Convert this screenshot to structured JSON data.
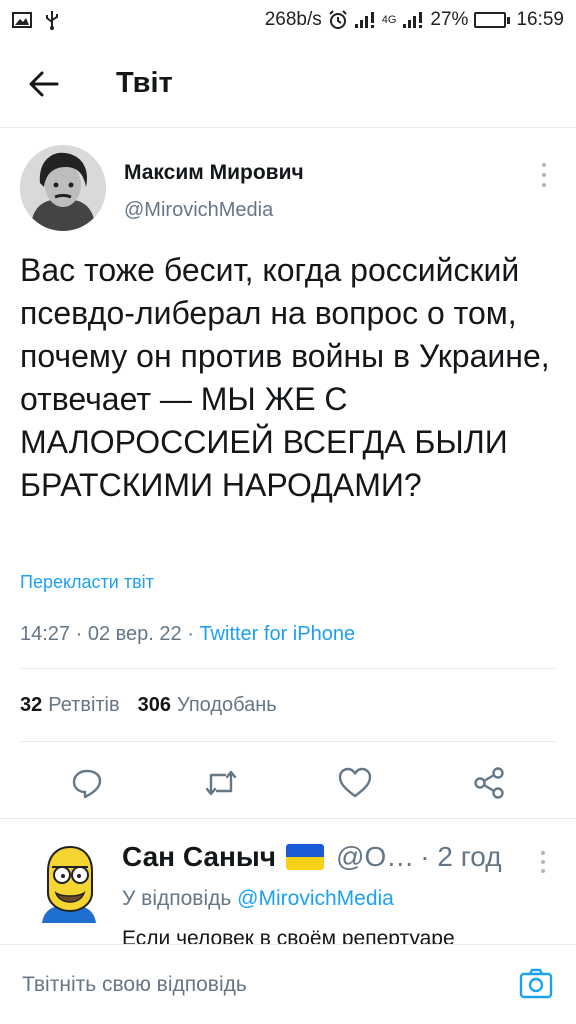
{
  "status_bar": {
    "speed": "268b/s",
    "network": "4G",
    "battery_percent": "27%",
    "battery_level": 0.27,
    "time": "16:59",
    "icons": [
      "image-icon",
      "usb-icon",
      "alarm-icon",
      "signal-icon",
      "signal-4g-icon",
      "battery-icon"
    ]
  },
  "header": {
    "title": "Твіт",
    "back_icon": "arrow-left-icon"
  },
  "tweet": {
    "author_name": "Максим Мирович",
    "author_handle": "@MirovichMedia",
    "text": "Вас тоже бесит, когда российский псевдо-либерал на вопрос о том, почему он против войны в Украине, отвечает — МЫ ЖЕ С МАЛОРОССИЕЙ ВСЕГДА БЫЛИ БРАТСКИМИ НАРОДАМИ?",
    "translate_label": "Перекласти твіт",
    "time": "14:27",
    "date": "02 вер. 22",
    "source": "Twitter for iPhone",
    "retweets_count": "32",
    "retweets_label": "Ретвітів",
    "likes_count": "306",
    "likes_label": "Уподобань"
  },
  "actions": [
    "reply-icon",
    "retweet-icon",
    "like-icon",
    "share-icon"
  ],
  "reply": {
    "author_name": "Сан Саныч",
    "handle": "@О…",
    "time": "2 год",
    "reply_to_label": "У відповідь",
    "reply_to_handle": "@MirovichMedia",
    "text": "Если человек в своём репертуаре"
  },
  "compose": {
    "placeholder": "Твітніть свою відповідь"
  },
  "colors": {
    "accent": "#1da1f2",
    "text": "#14171a",
    "secondary": "#657786",
    "border": "#e6ecf0",
    "flag_blue": "#1a5bd6",
    "flag_yellow": "#f7d117",
    "battery_green": "#2ecc40"
  }
}
